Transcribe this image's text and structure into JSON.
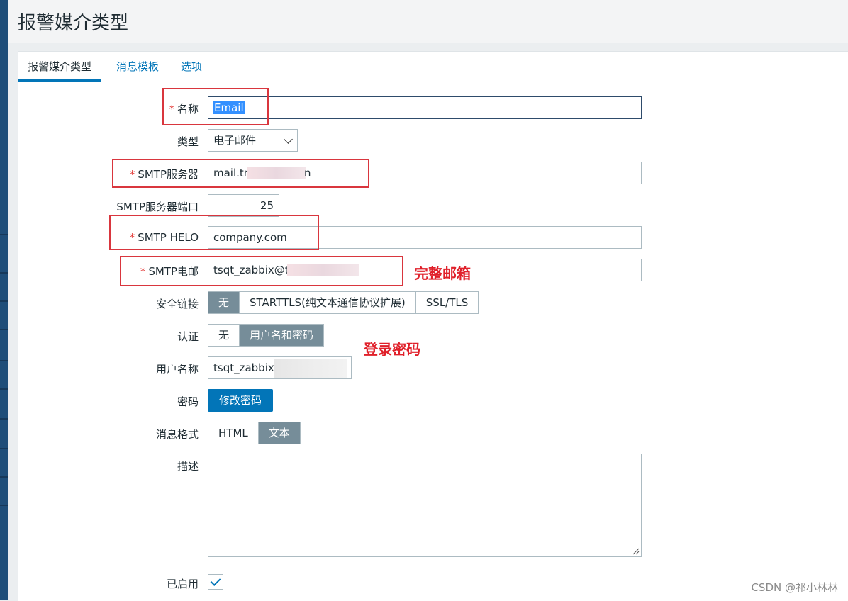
{
  "page": {
    "title": "报警媒介类型"
  },
  "tabs": [
    {
      "label": "报警媒介类型",
      "active": true
    },
    {
      "label": "消息模板",
      "active": false
    },
    {
      "label": "选项",
      "active": false
    }
  ],
  "form": {
    "name": {
      "label": "名称",
      "required": "*",
      "value": "Email"
    },
    "type": {
      "label": "类型",
      "value": "电子邮件"
    },
    "smtp_server": {
      "label": "SMTP服务器",
      "required": "*",
      "value_visible_start": "mail.tri",
      "value_visible_end": "n"
    },
    "smtp_port": {
      "label": "SMTP服务器端口",
      "value": "25"
    },
    "smtp_helo": {
      "label": "SMTP HELO",
      "required": "*",
      "value": "company.com"
    },
    "smtp_email": {
      "label": "SMTP电邮",
      "required": "*",
      "value_visible_start": "tsqt_zabbix@t"
    },
    "security": {
      "label": "安全链接",
      "options": [
        "无",
        "STARTTLS(纯文本通信协议扩展)",
        "SSL/TLS"
      ],
      "selected": "无"
    },
    "auth": {
      "label": "认证",
      "options": [
        "无",
        "用户名和密码"
      ],
      "selected": "用户名和密码"
    },
    "username": {
      "label": "用户名称",
      "value_visible_start": "tsqt_zabbix("
    },
    "password": {
      "label": "密码",
      "button": "修改密码"
    },
    "message_format": {
      "label": "消息格式",
      "options": [
        "HTML",
        "文本"
      ],
      "selected": "文本"
    },
    "description": {
      "label": "描述",
      "value": ""
    },
    "enabled": {
      "label": "已启用",
      "checked": true
    }
  },
  "annotations": {
    "full_email": "完整邮箱",
    "login_password": "登录密码"
  },
  "watermark": "CSDN @祁小林林",
  "colors": {
    "accent": "#0275b8",
    "annotation": "#e0202a",
    "segment_on": "#768d99"
  }
}
